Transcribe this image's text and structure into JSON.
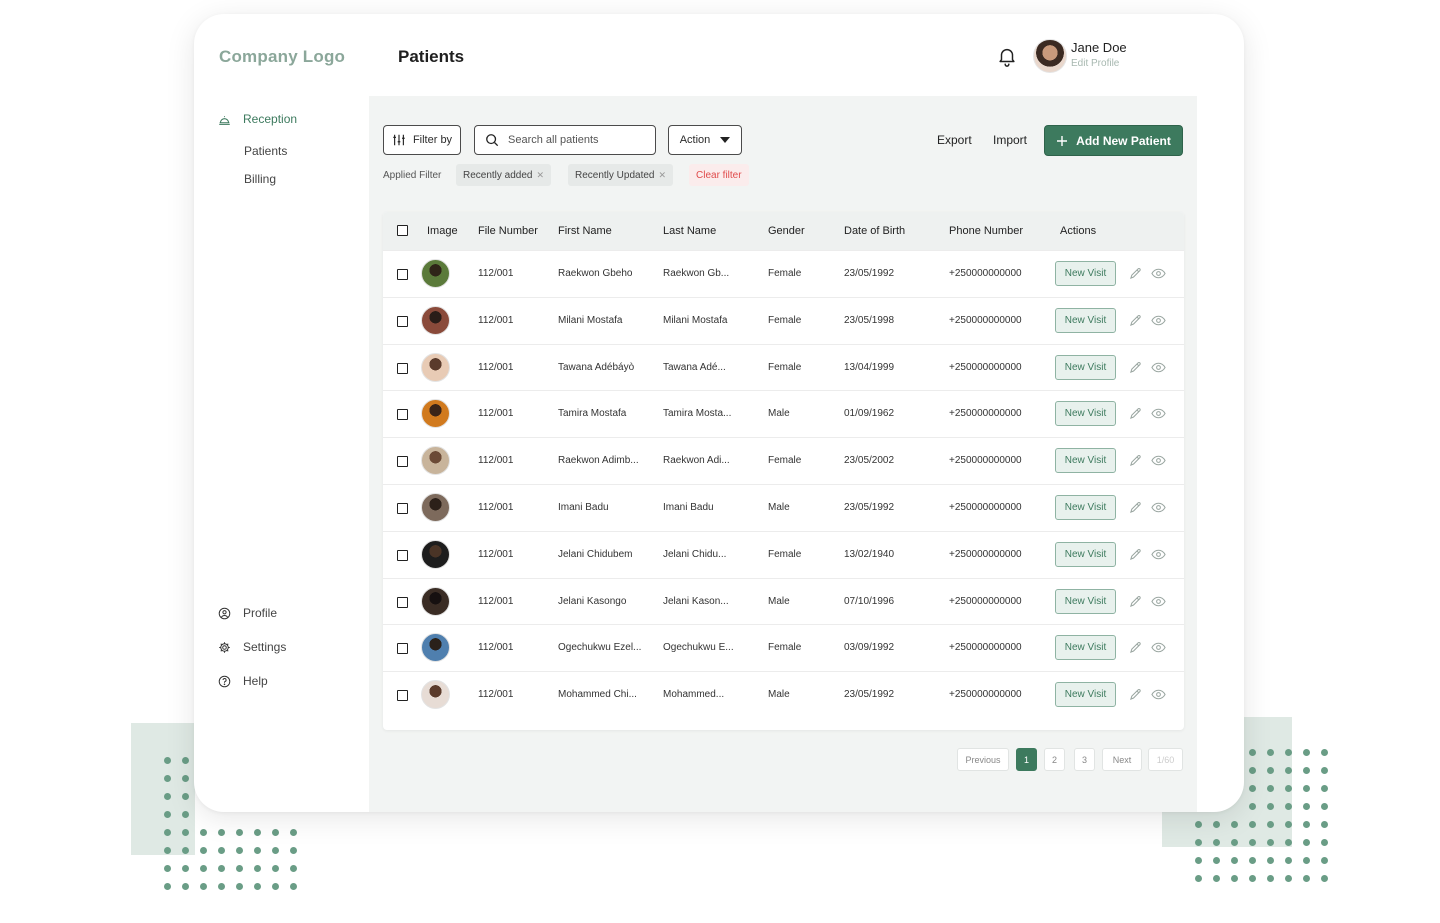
{
  "brand": {
    "logo_text": "Company Logo",
    "accent": "#3d7a5e"
  },
  "header": {
    "title": "Patients",
    "user_name": "Jane Doe",
    "edit_profile": "Edit Profile"
  },
  "sidebar": {
    "top": {
      "label": "Reception",
      "icon": "reception-bell-icon"
    },
    "sub_items": [
      {
        "label": "Patients"
      },
      {
        "label": "Billing"
      }
    ],
    "bottom_items": [
      {
        "label": "Profile",
        "icon": "profile-icon"
      },
      {
        "label": "Settings",
        "icon": "gear-icon"
      },
      {
        "label": "Help",
        "icon": "help-icon"
      }
    ]
  },
  "toolbar": {
    "filter_label": "Filter by",
    "search_placeholder": "Search all patients",
    "action_label": "Action",
    "export_label": "Export",
    "import_label": "Import",
    "add_label": "Add New Patient"
  },
  "filters": {
    "applied_label": "Applied Filter",
    "chips": [
      "Recently added",
      "Recently Updated"
    ],
    "clear_label": "Clear filter"
  },
  "table": {
    "columns": [
      "Image",
      "File Number",
      "First Name",
      "Last Name",
      "Gender",
      "Date of Birth",
      "Phone Number",
      "Actions"
    ],
    "rows": [
      {
        "file": "112/001",
        "first": "Raekwon Gbeho",
        "last": "Raekwon Gb...",
        "gender": "Female",
        "dob": "23/05/1992",
        "phone": "+250000000000",
        "action": "New Visit"
      },
      {
        "file": "112/001",
        "first": "Milani Mostafa",
        "last": "Milani Mostafa",
        "gender": "Female",
        "dob": "23/05/1998",
        "phone": "+250000000000",
        "action": "New Visit"
      },
      {
        "file": "112/001",
        "first": "Tawana Adébáyò",
        "last": "Tawana Adé...",
        "gender": "Female",
        "dob": "13/04/1999",
        "phone": "+250000000000",
        "action": "New Visit"
      },
      {
        "file": "112/001",
        "first": "Tamira Mostafa",
        "last": "Tamira Mosta...",
        "gender": "Male",
        "dob": "01/09/1962",
        "phone": "+250000000000",
        "action": "New Visit"
      },
      {
        "file": "112/001",
        "first": "Raekwon Adimb...",
        "last": "Raekwon Adi...",
        "gender": "Female",
        "dob": "23/05/2002",
        "phone": "+250000000000",
        "action": "New Visit"
      },
      {
        "file": "112/001",
        "first": "Imani Badu",
        "last": "Imani Badu",
        "gender": "Male",
        "dob": "23/05/1992",
        "phone": "+250000000000",
        "action": "New Visit"
      },
      {
        "file": "112/001",
        "first": "Jelani Chidubem",
        "last": "Jelani Chidu...",
        "gender": "Female",
        "dob": "13/02/1940",
        "phone": "+250000000000",
        "action": "New Visit"
      },
      {
        "file": "112/001",
        "first": "Jelani Kasongo",
        "last": "Jelani Kason...",
        "gender": "Male",
        "dob": "07/10/1996",
        "phone": "+250000000000",
        "action": "New Visit"
      },
      {
        "file": "112/001",
        "first": "Ogechukwu Ezel...",
        "last": "Ogechukwu E...",
        "gender": "Female",
        "dob": "03/09/1992",
        "phone": "+250000000000",
        "action": "New Visit"
      },
      {
        "file": "112/001",
        "first": "Mohammed Chi...",
        "last": "Mohammed...",
        "gender": "Male",
        "dob": "23/05/1992",
        "phone": "+250000000000",
        "action": "New Visit"
      }
    ]
  },
  "pagination": {
    "previous": "Previous",
    "pages": [
      "1",
      "2",
      "3"
    ],
    "current": "1",
    "next": "Next",
    "total": "1/60"
  }
}
